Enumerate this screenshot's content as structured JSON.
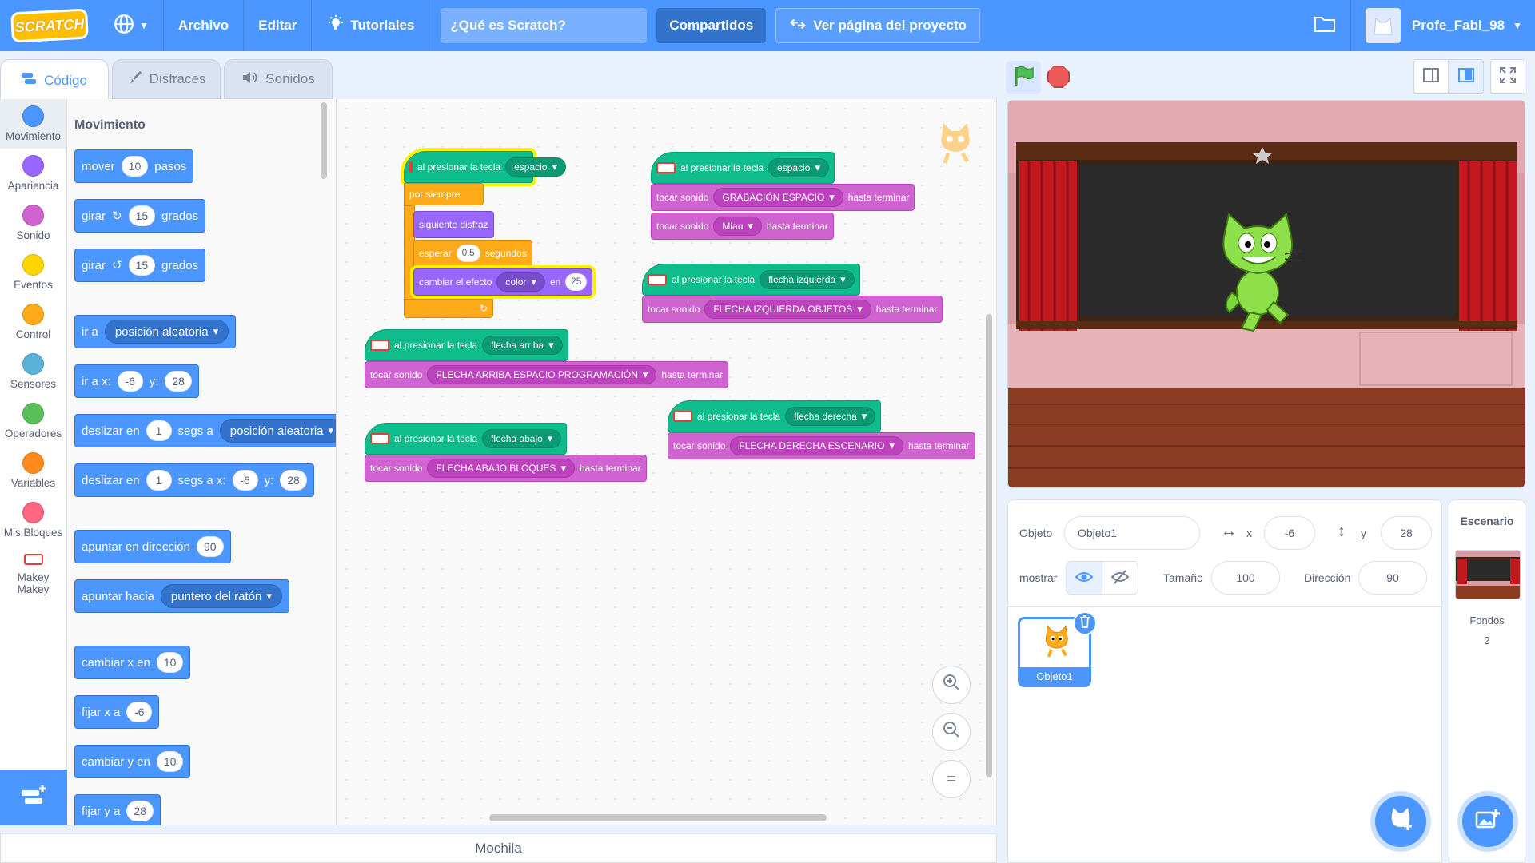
{
  "menubar": {
    "logo": "SCRATCH",
    "archivo": "Archivo",
    "editar": "Editar",
    "tutoriales": "Tutoriales",
    "project_title": "¿Qué es Scratch?",
    "compartidos": "Compartidos",
    "ver_pagina": "Ver página del proyecto",
    "username": "Profe_Fabi_98"
  },
  "tabs": {
    "codigo": "Código",
    "disfraces": "Disfraces",
    "sonidos": "Sonidos"
  },
  "categories": [
    {
      "label": "Movimiento",
      "color": "#4c97ff"
    },
    {
      "label": "Apariencia",
      "color": "#9966ff"
    },
    {
      "label": "Sonido",
      "color": "#cf63cf"
    },
    {
      "label": "Eventos",
      "color": "#ffd500"
    },
    {
      "label": "Control",
      "color": "#ffab19"
    },
    {
      "label": "Sensores",
      "color": "#5cb1d6"
    },
    {
      "label": "Operadores",
      "color": "#59c059"
    },
    {
      "label": "Variables",
      "color": "#ff8c1a"
    },
    {
      "label": "Mis Bloques",
      "color": "#ff6680"
    },
    {
      "label": "Makey Makey",
      "color": "#ffffff"
    }
  ],
  "palette": {
    "title": "Movimiento",
    "mover": "mover",
    "mover_val": "10",
    "pasos": "pasos",
    "girar": "girar",
    "girar_val": "15",
    "grados": "grados",
    "ir_a": "ir a",
    "posicion_aleatoria": "posición aleatoria",
    "ir_a_x": "ir a x:",
    "x_val": "-6",
    "y_label": "y:",
    "y_val": "28",
    "deslizar_en": "deslizar en",
    "segs_val": "1",
    "segs_a": "segs a",
    "segs_a_x": "segs a x:",
    "apuntar_direccion": "apuntar en dirección",
    "dir_val": "90",
    "apuntar_hacia": "apuntar hacia",
    "puntero": "puntero del ratón",
    "cambiar_x": "cambiar x en",
    "cambiar_x_val": "10",
    "fijar_x": "fijar x a",
    "fijar_x_val": "-6",
    "cambiar_y": "cambiar y en",
    "cambiar_y_val": "10",
    "fijar_y": "fijar y a",
    "fijar_y_val": "28"
  },
  "workspace": {
    "al_presionar": "al presionar la tecla",
    "espacio": "espacio",
    "por_siempre": "por siempre",
    "siguiente_disfraz": "siguiente disfraz",
    "esperar": "esperar",
    "esperar_val": "0.5",
    "segundos": "segundos",
    "cambiar_efecto": "cambiar el efecto",
    "color": "color",
    "en": "en",
    "efecto_val": "25",
    "tocar_sonido": "tocar sonido",
    "hasta_terminar": "hasta terminar",
    "grabacion_espacio": "GRABACIÓN ESPACIO",
    "miau": "Miau",
    "flecha_izquierda": "flecha izquierda",
    "flecha_izq_objetos": "FLECHA IZQUIERDA OBJETOS",
    "flecha_arriba": "flecha arriba",
    "flecha_arriba_esp": "FLECHA ARRIBA ESPACIO PROGRAMACIÓN",
    "flecha_derecha": "flecha derecha",
    "flecha_der_esc": "FLECHA DERECHA ESCENARIO",
    "flecha_abajo": "flecha abajo",
    "flecha_abajo_bloques": "FLECHA ABAJO BLOQUES"
  },
  "zoom": {
    "reset": "="
  },
  "mochila": "Mochila",
  "sprite_info": {
    "objeto_label": "Objeto",
    "objeto_name": "Objeto1",
    "x_label": "x",
    "x_val": "-6",
    "y_label": "y",
    "y_val": "28",
    "mostrar": "mostrar",
    "tamano_label": "Tamaño",
    "tamano_val": "100",
    "direccion_label": "Dirección",
    "direccion_val": "90"
  },
  "sprite_list": {
    "sprite1": "Objeto1"
  },
  "stage_pane": {
    "title": "Escenario",
    "fondos": "Fondos",
    "fondos_count": "2"
  }
}
